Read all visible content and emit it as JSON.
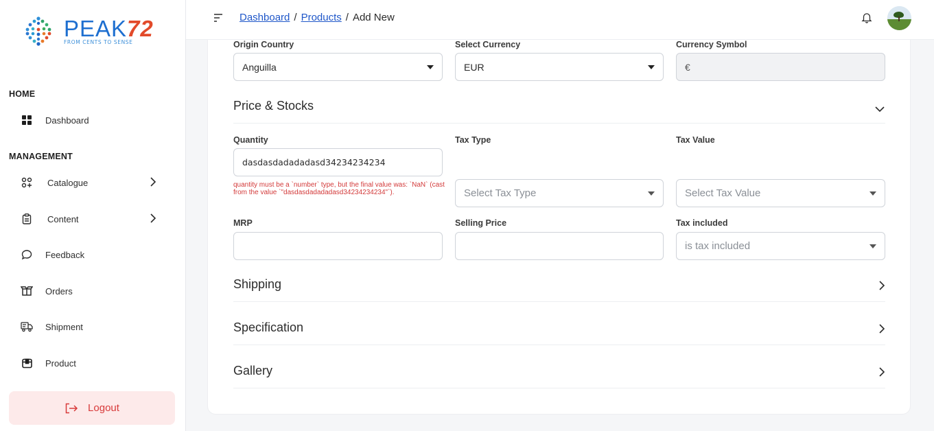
{
  "brand": {
    "name": "PEAK",
    "name_number": "72",
    "tagline": "FROM CENTS TO SENSE"
  },
  "sidebar": {
    "sections": [
      {
        "label": "HOME"
      },
      {
        "label": "MANAGEMENT"
      }
    ],
    "items": [
      {
        "label": "Dashboard",
        "icon": "grid-icon"
      },
      {
        "label": "Catalogue",
        "icon": "catalogue-icon",
        "has_children": true
      },
      {
        "label": "Content",
        "icon": "clipboard-icon",
        "has_children": true
      },
      {
        "label": "Feedback",
        "icon": "chat-bubble-icon"
      },
      {
        "label": "Orders",
        "icon": "box-open-icon"
      },
      {
        "label": "Shipment",
        "icon": "truck-icon"
      },
      {
        "label": "Product",
        "icon": "package-icon"
      }
    ],
    "logout_label": "Logout"
  },
  "header": {
    "breadcrumb": [
      {
        "label": "Dashboard",
        "link": true
      },
      {
        "label": "Products",
        "link": true
      },
      {
        "label": "Add New",
        "link": false
      }
    ],
    "separator": "/"
  },
  "form": {
    "origin_country": {
      "label": "Origin Country",
      "value": "Anguilla"
    },
    "select_currency": {
      "label": "Select Currency",
      "value": "EUR"
    },
    "currency_symbol": {
      "label": "Currency Symbol",
      "value": "€"
    },
    "price_stocks": {
      "title": "Price & Stocks",
      "quantity": {
        "label": "Quantity",
        "value": "dasdasdadadadasd34234234234",
        "error": "quantity must be a `number` type, but the final value was: `NaN` (cast from the value `\"dasdasdadadadasd34234234234\"`)."
      },
      "tax_type": {
        "label": "Tax Type",
        "placeholder": "Select Tax Type"
      },
      "tax_value": {
        "label": "Tax Value",
        "placeholder": "Select Tax Value"
      },
      "mrp": {
        "label": "MRP",
        "value": ""
      },
      "selling_price": {
        "label": "Selling Price",
        "value": ""
      },
      "tax_included": {
        "label": "Tax included",
        "placeholder": "is tax included"
      }
    },
    "sections": [
      {
        "title": "Shipping"
      },
      {
        "title": "Specification"
      },
      {
        "title": "Gallery"
      }
    ]
  },
  "colors": {
    "brand_blue": "#1e6fd0",
    "brand_red": "#e24a2a",
    "error": "#d33a3a",
    "link": "#1f57c9",
    "logout_bg": "#fdeaea"
  }
}
